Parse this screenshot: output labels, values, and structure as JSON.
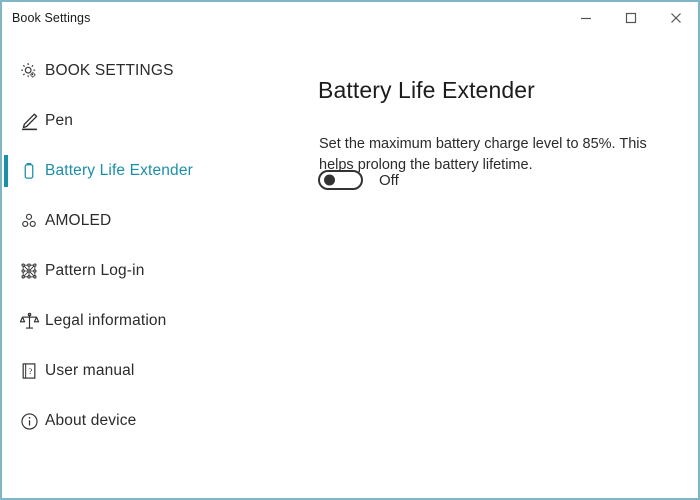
{
  "window": {
    "title": "Book Settings",
    "accent_color": "#1a8fa8",
    "border_color": "#7fb6c4",
    "controls": {
      "minimize": "minimize-button",
      "maximize": "maximize-button",
      "close": "close-button"
    }
  },
  "sidebar": {
    "items": [
      {
        "label": "BOOK SETTINGS",
        "icon": "gear-icon",
        "selected": false
      },
      {
        "label": "Pen",
        "icon": "pen-icon",
        "selected": false
      },
      {
        "label": "Battery Life Extender",
        "icon": "battery-icon",
        "selected": true
      },
      {
        "label": "AMOLED",
        "icon": "amoled-dots-icon",
        "selected": false
      },
      {
        "label": "Pattern Log-in",
        "icon": "pattern-grid-icon",
        "selected": false
      },
      {
        "label": "Legal information",
        "icon": "scales-icon",
        "selected": false
      },
      {
        "label": "User manual",
        "icon": "manual-book-icon",
        "selected": false
      },
      {
        "label": "About device",
        "icon": "info-circle-icon",
        "selected": false
      }
    ]
  },
  "main": {
    "title": "Battery Life Extender",
    "description": "Set the maximum battery charge level to 85%. This helps prolong the battery lifetime.",
    "toggle": {
      "state_label": "Off",
      "checked": false
    }
  }
}
